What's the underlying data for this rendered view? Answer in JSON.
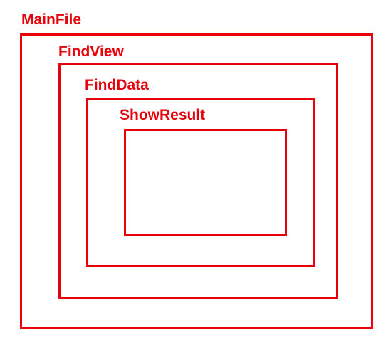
{
  "diagram": {
    "accent_color": "#e8000b",
    "nodes": [
      {
        "id": "mainfile",
        "label": "MainFile",
        "parent": null
      },
      {
        "id": "findview",
        "label": "FindView",
        "parent": "mainfile"
      },
      {
        "id": "finddata",
        "label": "FindData",
        "parent": "findview"
      },
      {
        "id": "showresult",
        "label": "ShowResult",
        "parent": "finddata"
      }
    ]
  }
}
